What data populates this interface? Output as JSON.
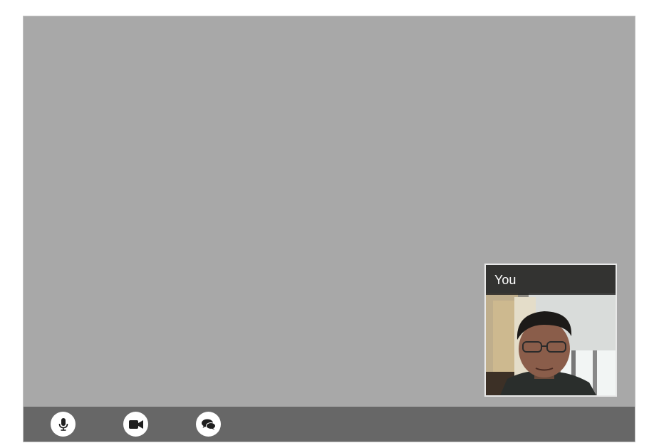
{
  "self_view": {
    "label": "You"
  },
  "controls": [
    {
      "name": "microphone",
      "icon": "microphone-icon"
    },
    {
      "name": "camera",
      "icon": "video-camera-icon"
    },
    {
      "name": "chat",
      "icon": "chat-bubbles-icon"
    }
  ],
  "colors": {
    "stage_background": "#a8a8a8",
    "control_bar": "#676767",
    "button_background": "#ffffff",
    "icon_color": "#1e1e1e"
  }
}
